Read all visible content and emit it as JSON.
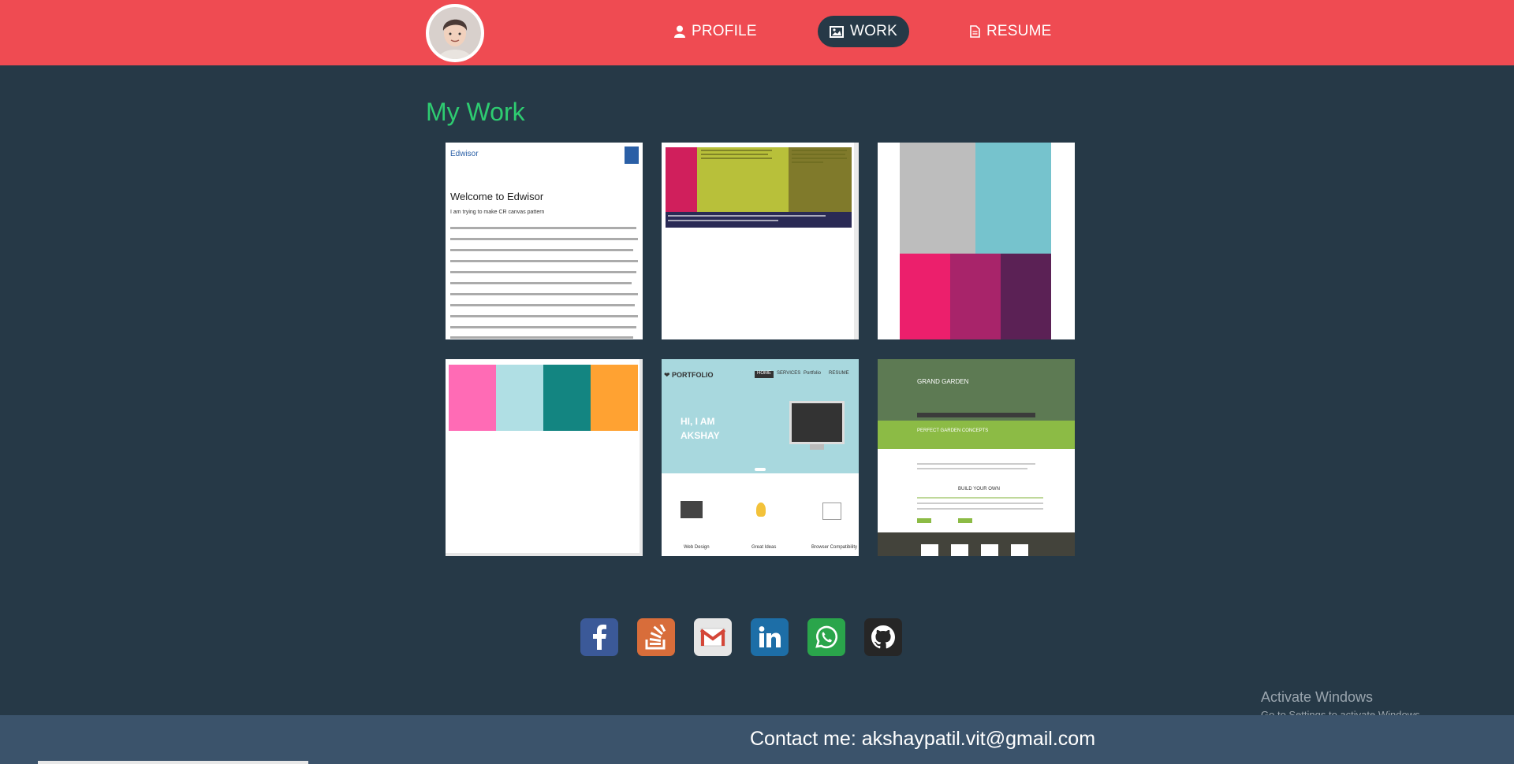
{
  "nav": {
    "avatar_icon": "avatar-icon",
    "profile_label": "PROFILE",
    "work_label": "WORK",
    "resume_label": "RESUME",
    "profile_icon": "user-icon",
    "work_icon": "image-icon",
    "resume_icon": "document-icon"
  },
  "main": {
    "title": "My Work"
  },
  "thumbnails": [
    {
      "name": "edwisor",
      "brand": "Edwisor",
      "title": "Welcome to Edwisor",
      "subtitle": "I am trying to make CR canvas pattern"
    },
    {
      "name": "colored-columns"
    },
    {
      "name": "grid-colors"
    },
    {
      "name": "color-boxes"
    },
    {
      "name": "portfolio",
      "logo": "❤ PORTFOLIO",
      "menu": [
        "HOME",
        "SERVICES",
        "Portfolio",
        "RESUME"
      ],
      "hero": [
        "HI, I AM",
        "AKSHAY"
      ],
      "features": [
        "Web Design",
        "Great Ideas",
        "Browser Compatibility"
      ]
    },
    {
      "name": "grand-garden",
      "logo": "GRAND GARDEN",
      "headline": "PERFECT GARDEN CONCEPTS",
      "section": "BUILD YOUR OWN"
    }
  ],
  "social": [
    {
      "name": "facebook",
      "icon": "facebook-icon"
    },
    {
      "name": "stackoverflow",
      "icon": "stackoverflow-icon"
    },
    {
      "name": "gmail",
      "icon": "gmail-icon"
    },
    {
      "name": "linkedin",
      "icon": "linkedin-icon"
    },
    {
      "name": "whatsapp",
      "icon": "whatsapp-icon"
    },
    {
      "name": "github",
      "icon": "github-icon"
    }
  ],
  "watermark": {
    "line1": "Activate Windows",
    "line2": "Go to Settings to activate Windows."
  },
  "footer": {
    "contact": "Contact me: akshaypatil.vit@gmail.com"
  },
  "colors": {
    "nav_bg": "#ef4b52",
    "page_bg": "#263947",
    "heading": "#2ecc71",
    "footer_bg": "#3b536b"
  }
}
